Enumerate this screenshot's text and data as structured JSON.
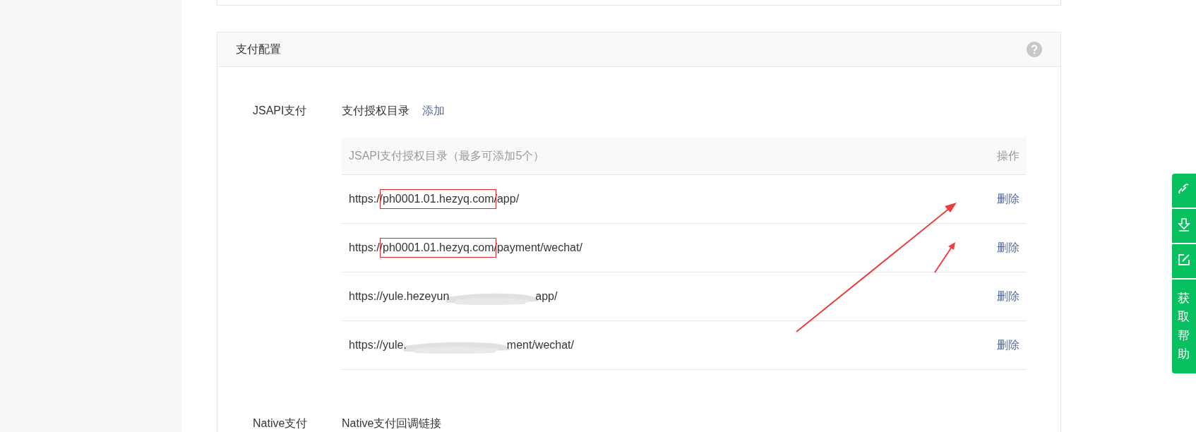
{
  "section": {
    "title": "支付配置"
  },
  "jsapi": {
    "label": "JSAPI支付",
    "field_label": "支付授权目录",
    "add_link": "添加",
    "table": {
      "columns": [
        "JSAPI支付授权目录（最多可添加5个）",
        "操作"
      ],
      "rows": [
        {
          "url_parts": [
            "https://",
            "ph0001.01.hezyq.com",
            "/app/"
          ],
          "highlighted": true,
          "redacted": false,
          "action": "删除"
        },
        {
          "url_parts": [
            "https://",
            "ph0001.01.hezyq.com",
            "/payment/wechat/"
          ],
          "highlighted": true,
          "redacted": false,
          "action": "删除"
        },
        {
          "url_parts": [
            "https://yule.hezeyun",
            "app/"
          ],
          "highlighted": false,
          "redacted": true,
          "action": "删除"
        },
        {
          "url_parts": [
            "https://yule.",
            "ment/wechat/"
          ],
          "highlighted": false,
          "redacted": true,
          "action": "删除"
        }
      ]
    }
  },
  "native": {
    "label": "Native支付",
    "field_label": "Native支付回调链接"
  },
  "help_tab": {
    "label": "获取帮助"
  }
}
